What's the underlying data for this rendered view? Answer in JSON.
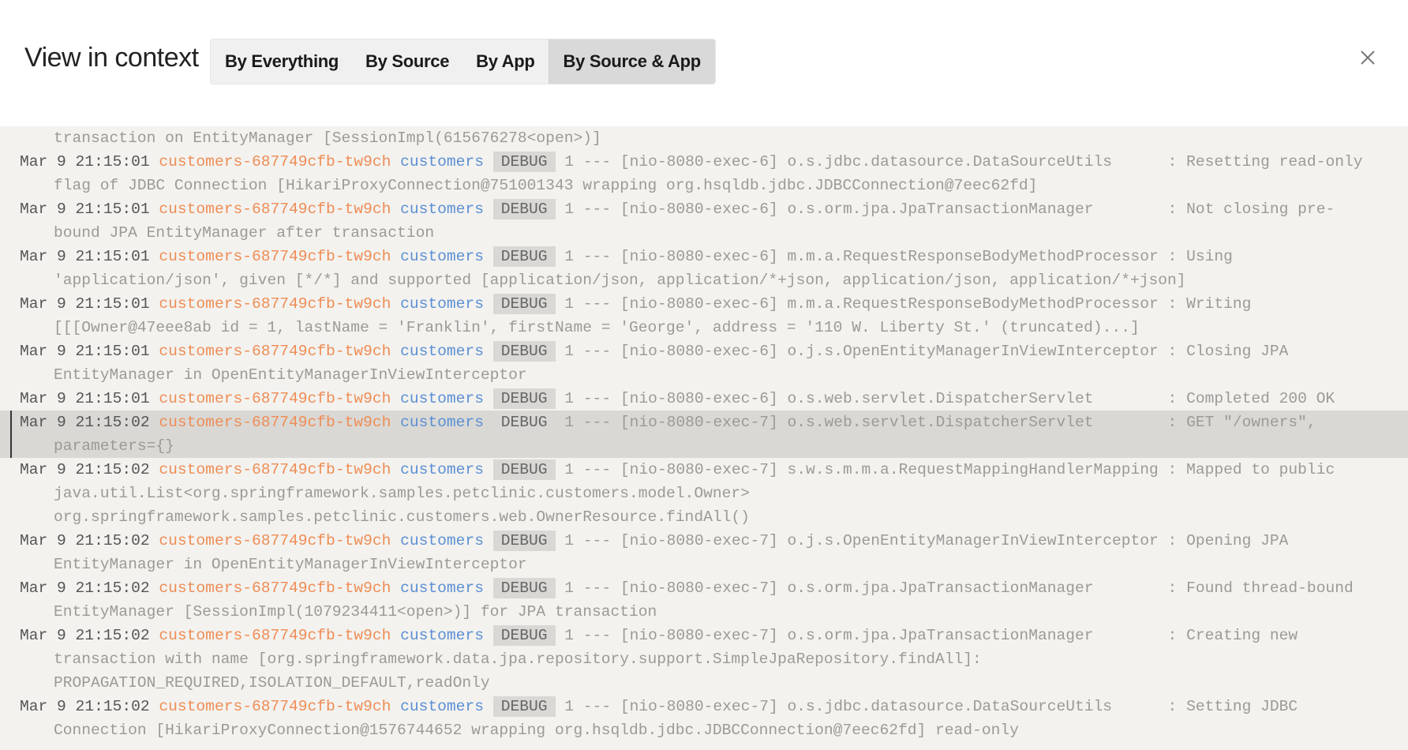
{
  "header": {
    "title": "View in context",
    "tabs": [
      {
        "label": "By Everything"
      },
      {
        "label": "By Source"
      },
      {
        "label": "By App"
      },
      {
        "label": "By Source & App"
      }
    ],
    "active_tab": "By Source & App",
    "close_icon": "close-icon"
  },
  "colors": {
    "pod": "#ef8d55",
    "app": "#5b8fd3",
    "background": "#f3f2ef",
    "highlight": "#d9d8d5"
  },
  "partial_line": "transaction on EntityManager [SessionImpl(615676278<open>)]",
  "entries": [
    {
      "ts": "Mar 9 21:15:01",
      "pod": "customers-687749cfb-tw9ch",
      "app": "customers",
      "level": "DEBUG",
      "rest": "1 --- [nio-8080-exec-6] o.s.jdbc.datasource.DataSourceUtils      : Resetting read-only",
      "cont": [
        "flag of JDBC Connection [HikariProxyConnection@751001343 wrapping org.hsqldb.jdbc.JDBCConnection@7eec62fd]"
      ]
    },
    {
      "ts": "Mar 9 21:15:01",
      "pod": "customers-687749cfb-tw9ch",
      "app": "customers",
      "level": "DEBUG",
      "rest": "1 --- [nio-8080-exec-6] o.s.orm.jpa.JpaTransactionManager        : Not closing pre-",
      "cont": [
        "bound JPA EntityManager after transaction"
      ]
    },
    {
      "ts": "Mar 9 21:15:01",
      "pod": "customers-687749cfb-tw9ch",
      "app": "customers",
      "level": "DEBUG",
      "rest": "1 --- [nio-8080-exec-6] m.m.a.RequestResponseBodyMethodProcessor : Using",
      "cont": [
        "'application/json', given [*/*] and supported [application/json, application/*+json, application/json, application/*+json]"
      ]
    },
    {
      "ts": "Mar 9 21:15:01",
      "pod": "customers-687749cfb-tw9ch",
      "app": "customers",
      "level": "DEBUG",
      "rest": "1 --- [nio-8080-exec-6] m.m.a.RequestResponseBodyMethodProcessor : Writing",
      "cont": [
        "[[[Owner@47eee8ab id = 1, lastName = 'Franklin', firstName = 'George', address = '110 W. Liberty St.' (truncated)...]"
      ]
    },
    {
      "ts": "Mar 9 21:15:01",
      "pod": "customers-687749cfb-tw9ch",
      "app": "customers",
      "level": "DEBUG",
      "rest": "1 --- [nio-8080-exec-6] o.j.s.OpenEntityManagerInViewInterceptor : Closing JPA",
      "cont": [
        "EntityManager in OpenEntityManagerInViewInterceptor"
      ]
    },
    {
      "ts": "Mar 9 21:15:01",
      "pod": "customers-687749cfb-tw9ch",
      "app": "customers",
      "level": "DEBUG",
      "rest": "1 --- [nio-8080-exec-6] o.s.web.servlet.DispatcherServlet        : Completed 200 OK",
      "cont": []
    },
    {
      "ts": "Mar 9 21:15:02",
      "pod": "customers-687749cfb-tw9ch",
      "app": "customers",
      "level": "DEBUG",
      "rest": "1 --- [nio-8080-exec-7] o.s.web.servlet.DispatcherServlet        : GET \"/owners\",",
      "cont": [
        "parameters={}"
      ],
      "highlighted": true
    },
    {
      "ts": "Mar 9 21:15:02",
      "pod": "customers-687749cfb-tw9ch",
      "app": "customers",
      "level": "DEBUG",
      "rest": "1 --- [nio-8080-exec-7] s.w.s.m.m.a.RequestMappingHandlerMapping : Mapped to public",
      "cont": [
        "java.util.List<org.springframework.samples.petclinic.customers.model.Owner>",
        "org.springframework.samples.petclinic.customers.web.OwnerResource.findAll()"
      ]
    },
    {
      "ts": "Mar 9 21:15:02",
      "pod": "customers-687749cfb-tw9ch",
      "app": "customers",
      "level": "DEBUG",
      "rest": "1 --- [nio-8080-exec-7] o.j.s.OpenEntityManagerInViewInterceptor : Opening JPA",
      "cont": [
        "EntityManager in OpenEntityManagerInViewInterceptor"
      ]
    },
    {
      "ts": "Mar 9 21:15:02",
      "pod": "customers-687749cfb-tw9ch",
      "app": "customers",
      "level": "DEBUG",
      "rest": "1 --- [nio-8080-exec-7] o.s.orm.jpa.JpaTransactionManager        : Found thread-bound",
      "cont": [
        "EntityManager [SessionImpl(1079234411<open>)] for JPA transaction"
      ]
    },
    {
      "ts": "Mar 9 21:15:02",
      "pod": "customers-687749cfb-tw9ch",
      "app": "customers",
      "level": "DEBUG",
      "rest": "1 --- [nio-8080-exec-7] o.s.orm.jpa.JpaTransactionManager        : Creating new",
      "cont": [
        "transaction with name [org.springframework.data.jpa.repository.support.SimpleJpaRepository.findAll]:",
        "PROPAGATION_REQUIRED,ISOLATION_DEFAULT,readOnly"
      ]
    },
    {
      "ts": "Mar 9 21:15:02",
      "pod": "customers-687749cfb-tw9ch",
      "app": "customers",
      "level": "DEBUG",
      "rest": "1 --- [nio-8080-exec-7] o.s.jdbc.datasource.DataSourceUtils      : Setting JDBC",
      "cont": [
        "Connection [HikariProxyConnection@1576744652 wrapping org.hsqldb.jdbc.JDBCConnection@7eec62fd] read-only"
      ]
    }
  ]
}
